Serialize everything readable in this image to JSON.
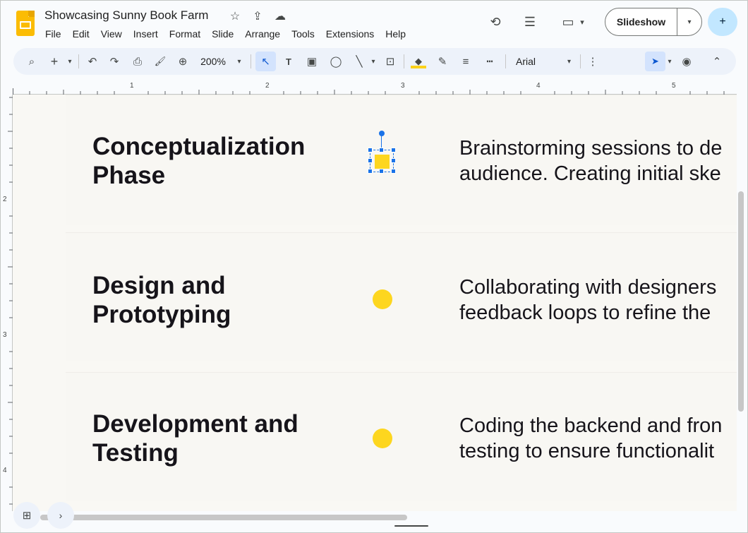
{
  "app": {
    "title": "Showcasing Sunny Book Farm",
    "star_icon": "☆",
    "move_icon": "⇪",
    "cloud_icon": "☁"
  },
  "menu": {
    "items": [
      "File",
      "Edit",
      "View",
      "Insert",
      "Format",
      "Slide",
      "Arrange",
      "Tools",
      "Extensions",
      "Help"
    ]
  },
  "header": {
    "history_icon": "⟲",
    "comments_icon": "☰",
    "meet_icon": "▭",
    "meet_caret": "▾",
    "slideshow_label": "Slideshow",
    "slideshow_caret": "▾",
    "share_icon": "+"
  },
  "toolbar": {
    "search_icon": "⌕",
    "new_icon": "+",
    "new_caret": "▾",
    "undo_icon": "↶",
    "redo_icon": "↷",
    "print_icon": "⎙",
    "paint_format_icon": "🖌",
    "zoom_icon": "⊕",
    "zoom_value": "200%",
    "zoom_caret": "▾",
    "select_icon": "↖",
    "textbox_icon": "T",
    "image_icon": "▣",
    "shape_icon": "◯",
    "line_icon": "╲",
    "line_caret": "▾",
    "placeholder_icon": "⊡",
    "fill_icon": "◆",
    "border_color_icon": "✎",
    "border_weight_icon": "≡",
    "border_dash_icon": "┅",
    "font": "Arial",
    "font_caret": "▾",
    "more_icon": "⋮",
    "pointer_icon": "➤",
    "pointer_caret": "▾",
    "record_icon": "◉",
    "collapse_icon": "⌃"
  },
  "ruler": {
    "h_labels": [
      "1",
      "2",
      "3",
      "4",
      "5"
    ],
    "v_labels": [
      "2",
      "3",
      "4"
    ]
  },
  "slide": {
    "phases": [
      {
        "title_line1": "Conceptualization",
        "title_line2": "Phase",
        "desc_line1": "Brainstorming sessions to de",
        "desc_line2": "audience. Creating initial ske"
      },
      {
        "title_line1": "Design and",
        "title_line2": "Prototyping",
        "desc_line1": "Collaborating with designers",
        "desc_line2": "feedback loops to refine the"
      },
      {
        "title_line1": "Development and",
        "title_line2": "Testing",
        "desc_line1": "Coding the backend and fron",
        "desc_line2": "testing to ensure functionalit"
      }
    ],
    "accent_color": "#fdd61f"
  },
  "bottom": {
    "grid_icon": "⊞",
    "next_icon": "›"
  }
}
